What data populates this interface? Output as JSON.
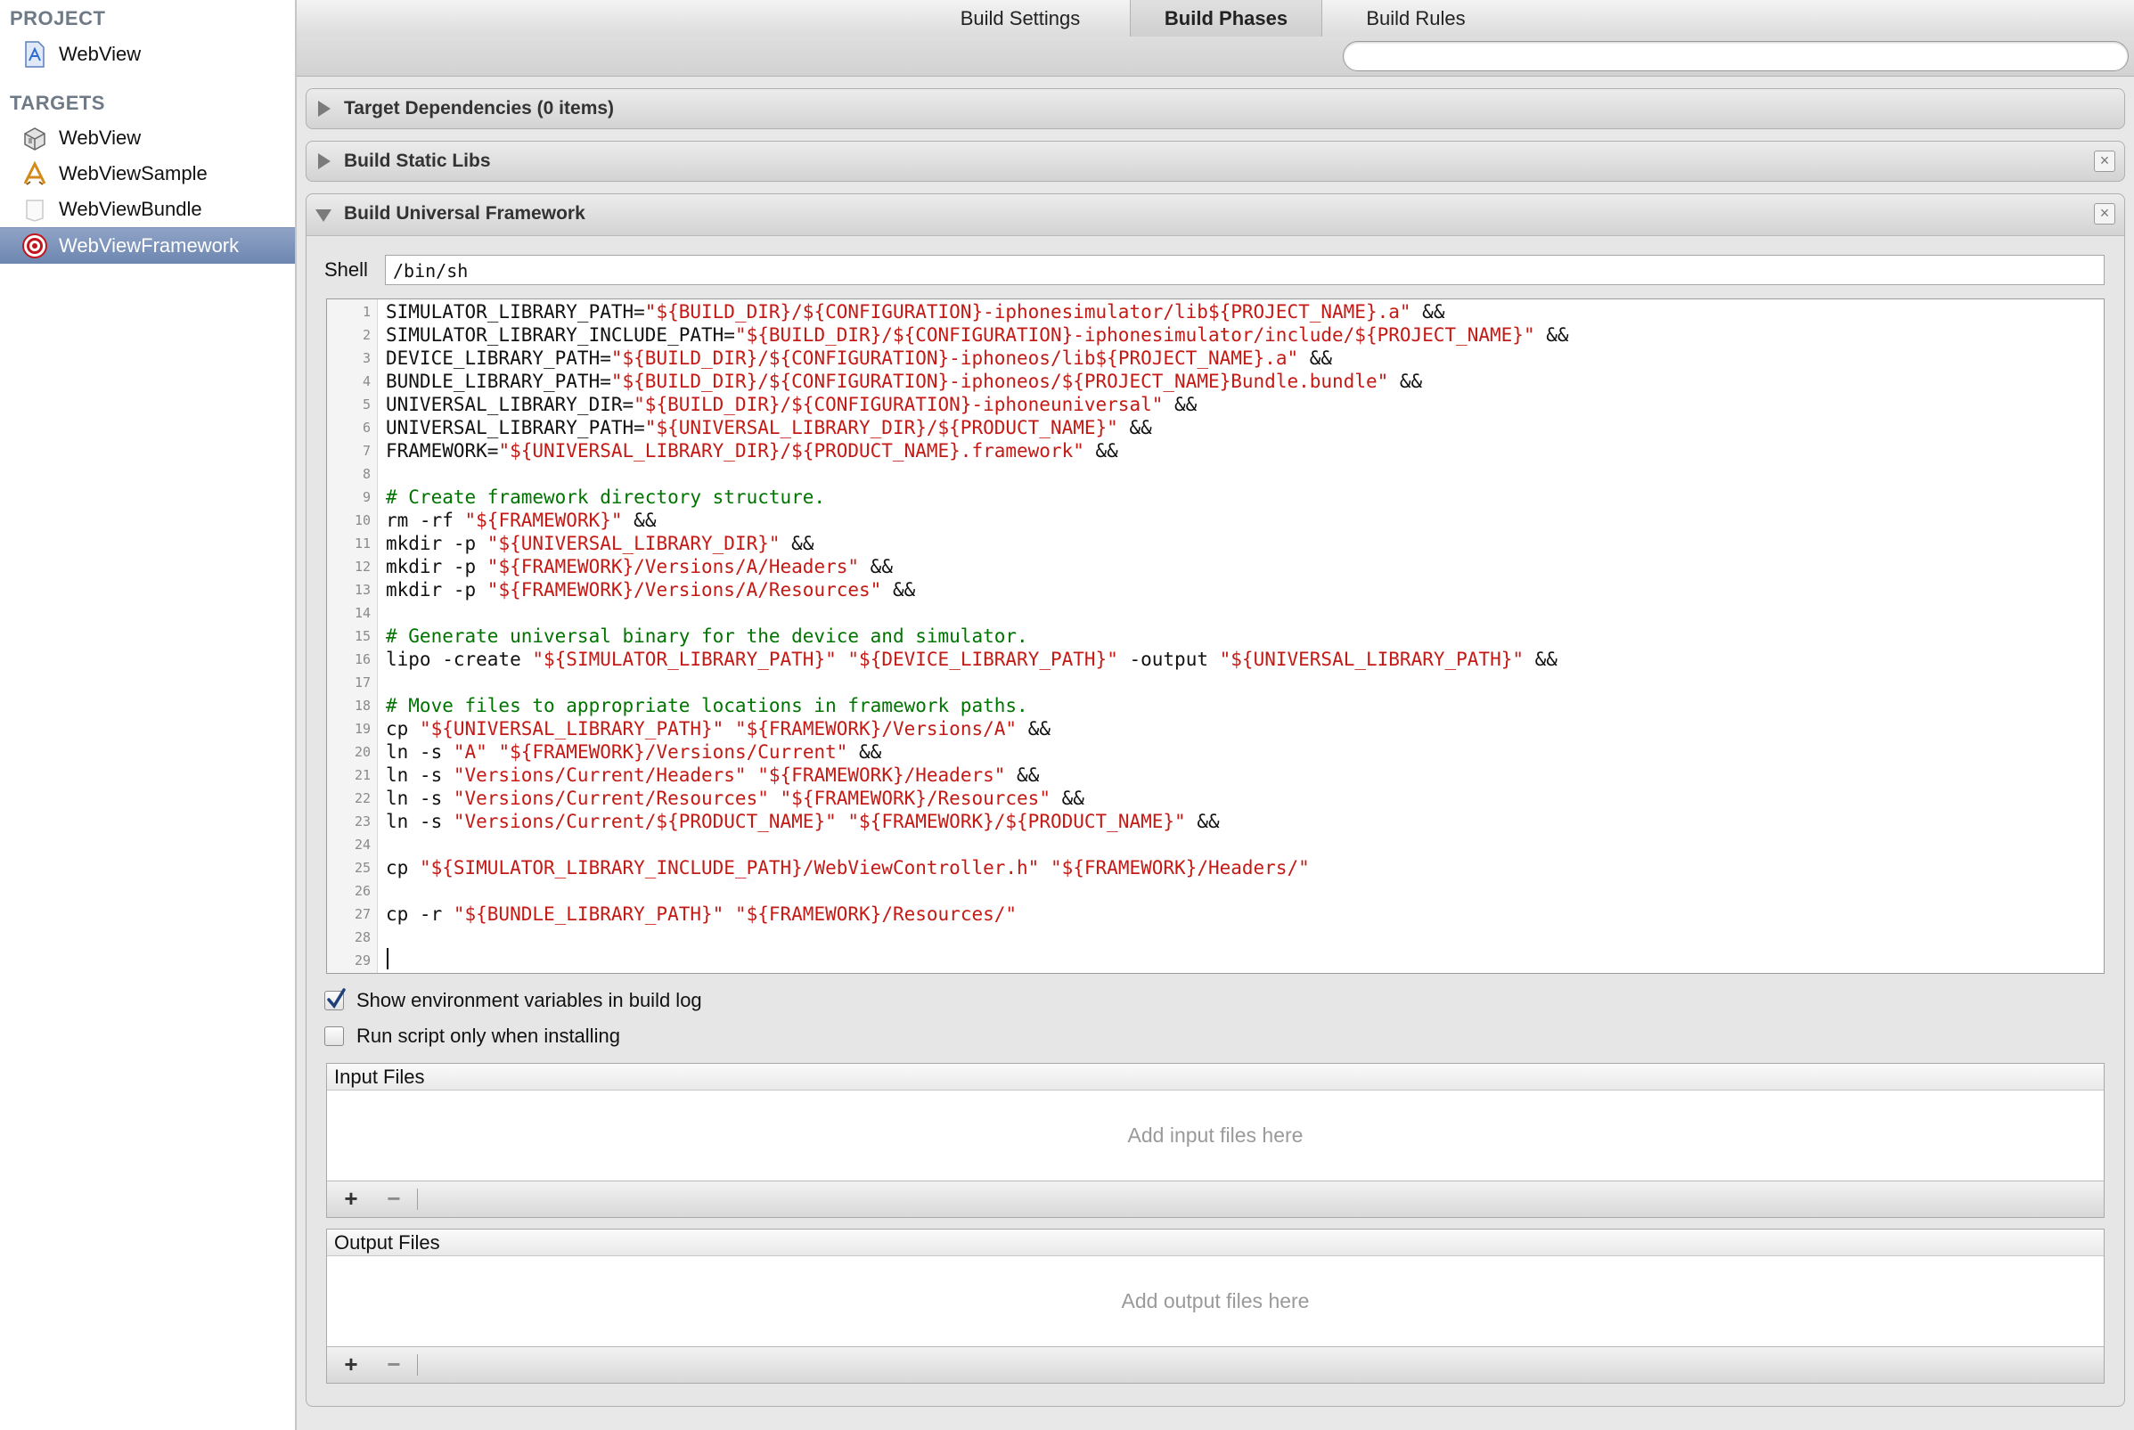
{
  "sidebar": {
    "project_header": "PROJECT",
    "project": {
      "label": "WebView",
      "icon": "xcode-project-icon"
    },
    "targets_header": "TARGETS",
    "targets": [
      {
        "label": "WebView",
        "icon": "static-library-icon"
      },
      {
        "label": "WebViewSample",
        "icon": "app-target-icon"
      },
      {
        "label": "WebViewBundle",
        "icon": "bundle-icon"
      },
      {
        "label": "WebViewFramework",
        "icon": "aggregate-target-icon",
        "selected": true
      }
    ]
  },
  "tabs": [
    {
      "label": "Build Settings"
    },
    {
      "label": "Build Phases",
      "active": true
    },
    {
      "label": "Build Rules"
    }
  ],
  "search": {
    "placeholder": "",
    "value": ""
  },
  "phases": {
    "target_dependencies": {
      "title": "Target Dependencies (0 items)",
      "expanded": false
    },
    "build_static_libs": {
      "title": "Build Static Libs",
      "expanded": false
    },
    "build_universal_framework": {
      "title": "Build Universal Framework",
      "expanded": true,
      "shell_label": "Shell",
      "shell_value": "/bin/sh",
      "script_lines": [
        {
          "n": "1",
          "segments": [
            {
              "t": "SIMULATOR_LIBRARY_PATH=",
              "k": "p"
            },
            {
              "t": "\"${BUILD_DIR}/${CONFIGURATION}-iphonesimulator/lib${PROJECT_NAME}.a\"",
              "k": "s"
            },
            {
              "t": " &&",
              "k": "p"
            }
          ]
        },
        {
          "n": "2",
          "segments": [
            {
              "t": "SIMULATOR_LIBRARY_INCLUDE_PATH=",
              "k": "p"
            },
            {
              "t": "\"${BUILD_DIR}/${CONFIGURATION}-iphonesimulator/include/${PROJECT_NAME}\"",
              "k": "s"
            },
            {
              "t": " &&",
              "k": "p"
            }
          ]
        },
        {
          "n": "3",
          "segments": [
            {
              "t": "DEVICE_LIBRARY_PATH=",
              "k": "p"
            },
            {
              "t": "\"${BUILD_DIR}/${CONFIGURATION}-iphoneos/lib${PROJECT_NAME}.a\"",
              "k": "s"
            },
            {
              "t": " &&",
              "k": "p"
            }
          ]
        },
        {
          "n": "4",
          "segments": [
            {
              "t": "BUNDLE_LIBRARY_PATH=",
              "k": "p"
            },
            {
              "t": "\"${BUILD_DIR}/${CONFIGURATION}-iphoneos/${PROJECT_NAME}Bundle.bundle\"",
              "k": "s"
            },
            {
              "t": " &&",
              "k": "p"
            }
          ]
        },
        {
          "n": "5",
          "segments": [
            {
              "t": "UNIVERSAL_LIBRARY_DIR=",
              "k": "p"
            },
            {
              "t": "\"${BUILD_DIR}/${CONFIGURATION}-iphoneuniversal\"",
              "k": "s"
            },
            {
              "t": " &&",
              "k": "p"
            }
          ]
        },
        {
          "n": "6",
          "segments": [
            {
              "t": "UNIVERSAL_LIBRARY_PATH=",
              "k": "p"
            },
            {
              "t": "\"${UNIVERSAL_LIBRARY_DIR}/${PRODUCT_NAME}\"",
              "k": "s"
            },
            {
              "t": " &&",
              "k": "p"
            }
          ]
        },
        {
          "n": "7",
          "segments": [
            {
              "t": "FRAMEWORK=",
              "k": "p"
            },
            {
              "t": "\"${UNIVERSAL_LIBRARY_DIR}/${PRODUCT_NAME}.framework\"",
              "k": "s"
            },
            {
              "t": " &&",
              "k": "p"
            }
          ]
        },
        {
          "n": "8",
          "segments": []
        },
        {
          "n": "9",
          "segments": [
            {
              "t": "# Create framework directory structure.",
              "k": "c"
            }
          ]
        },
        {
          "n": "10",
          "segments": [
            {
              "t": "rm -rf ",
              "k": "p"
            },
            {
              "t": "\"${FRAMEWORK}\"",
              "k": "s"
            },
            {
              "t": " &&",
              "k": "p"
            }
          ]
        },
        {
          "n": "11",
          "segments": [
            {
              "t": "mkdir -p ",
              "k": "p"
            },
            {
              "t": "\"${UNIVERSAL_LIBRARY_DIR}\"",
              "k": "s"
            },
            {
              "t": " &&",
              "k": "p"
            }
          ]
        },
        {
          "n": "12",
          "segments": [
            {
              "t": "mkdir -p ",
              "k": "p"
            },
            {
              "t": "\"${FRAMEWORK}/Versions/A/Headers\"",
              "k": "s"
            },
            {
              "t": " &&",
              "k": "p"
            }
          ]
        },
        {
          "n": "13",
          "segments": [
            {
              "t": "mkdir -p ",
              "k": "p"
            },
            {
              "t": "\"${FRAMEWORK}/Versions/A/Resources\"",
              "k": "s"
            },
            {
              "t": " &&",
              "k": "p"
            }
          ]
        },
        {
          "n": "14",
          "segments": []
        },
        {
          "n": "15",
          "segments": [
            {
              "t": "# Generate universal binary for the device and simulator.",
              "k": "c"
            }
          ]
        },
        {
          "n": "16",
          "segments": [
            {
              "t": "lipo -create ",
              "k": "p"
            },
            {
              "t": "\"${SIMULATOR_LIBRARY_PATH}\"",
              "k": "s"
            },
            {
              "t": " ",
              "k": "p"
            },
            {
              "t": "\"${DEVICE_LIBRARY_PATH}\"",
              "k": "s"
            },
            {
              "t": " -output ",
              "k": "p"
            },
            {
              "t": "\"${UNIVERSAL_LIBRARY_PATH}\"",
              "k": "s"
            },
            {
              "t": " &&",
              "k": "p"
            }
          ]
        },
        {
          "n": "17",
          "segments": []
        },
        {
          "n": "18",
          "segments": [
            {
              "t": "# Move files to appropriate locations in framework paths.",
              "k": "c"
            }
          ]
        },
        {
          "n": "19",
          "segments": [
            {
              "t": "cp ",
              "k": "p"
            },
            {
              "t": "\"${UNIVERSAL_LIBRARY_PATH}\"",
              "k": "s"
            },
            {
              "t": " ",
              "k": "p"
            },
            {
              "t": "\"${FRAMEWORK}/Versions/A\"",
              "k": "s"
            },
            {
              "t": " &&",
              "k": "p"
            }
          ]
        },
        {
          "n": "20",
          "segments": [
            {
              "t": "ln -s ",
              "k": "p"
            },
            {
              "t": "\"A\"",
              "k": "s"
            },
            {
              "t": " ",
              "k": "p"
            },
            {
              "t": "\"${FRAMEWORK}/Versions/Current\"",
              "k": "s"
            },
            {
              "t": " &&",
              "k": "p"
            }
          ]
        },
        {
          "n": "21",
          "segments": [
            {
              "t": "ln -s ",
              "k": "p"
            },
            {
              "t": "\"Versions/Current/Headers\"",
              "k": "s"
            },
            {
              "t": " ",
              "k": "p"
            },
            {
              "t": "\"${FRAMEWORK}/Headers\"",
              "k": "s"
            },
            {
              "t": " &&",
              "k": "p"
            }
          ]
        },
        {
          "n": "22",
          "segments": [
            {
              "t": "ln -s ",
              "k": "p"
            },
            {
              "t": "\"Versions/Current/Resources\"",
              "k": "s"
            },
            {
              "t": " ",
              "k": "p"
            },
            {
              "t": "\"${FRAMEWORK}/Resources\"",
              "k": "s"
            },
            {
              "t": " &&",
              "k": "p"
            }
          ]
        },
        {
          "n": "23",
          "segments": [
            {
              "t": "ln -s ",
              "k": "p"
            },
            {
              "t": "\"Versions/Current/${PRODUCT_NAME}\"",
              "k": "s"
            },
            {
              "t": " ",
              "k": "p"
            },
            {
              "t": "\"${FRAMEWORK}/${PRODUCT_NAME}\"",
              "k": "s"
            },
            {
              "t": " &&",
              "k": "p"
            }
          ]
        },
        {
          "n": "24",
          "segments": []
        },
        {
          "n": "25",
          "segments": [
            {
              "t": "cp ",
              "k": "p"
            },
            {
              "t": "\"${SIMULATOR_LIBRARY_INCLUDE_PATH}/WebViewController.h\"",
              "k": "s"
            },
            {
              "t": " ",
              "k": "p"
            },
            {
              "t": "\"${FRAMEWORK}/Headers/\"",
              "k": "s"
            }
          ]
        },
        {
          "n": "26",
          "segments": []
        },
        {
          "n": "27",
          "segments": [
            {
              "t": "cp -r ",
              "k": "p"
            },
            {
              "t": "\"${BUNDLE_LIBRARY_PATH}\"",
              "k": "s"
            },
            {
              "t": " ",
              "k": "p"
            },
            {
              "t": "\"${FRAMEWORK}/Resources/\"",
              "k": "s"
            }
          ]
        },
        {
          "n": "28",
          "segments": []
        },
        {
          "n": "29",
          "segments": []
        }
      ],
      "show_env_label": "Show environment variables in build log",
      "show_env_checked": true,
      "run_install_label": "Run script only when installing",
      "run_install_checked": false,
      "input_files": {
        "header": "Input Files",
        "empty_text": "Add input files here"
      },
      "output_files": {
        "header": "Output Files",
        "empty_text": "Add output files here"
      },
      "add_label": "+",
      "remove_label": "−"
    }
  },
  "colors": {
    "string": "#c41a16",
    "comment": "#007400",
    "selection": "#7189b3",
    "section_header": "#6f7a87"
  }
}
